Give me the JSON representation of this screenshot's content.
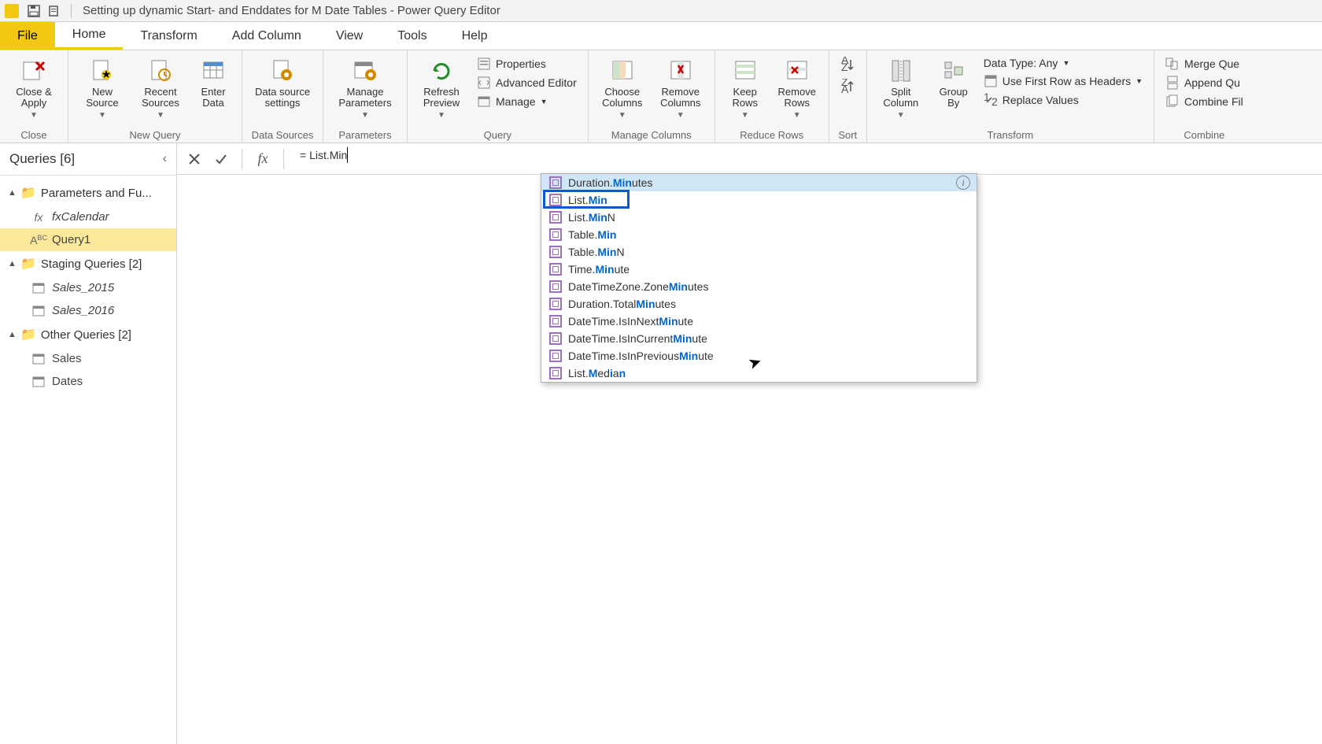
{
  "window": {
    "title": "Setting up dynamic Start- and Enddates for M Date Tables - Power Query Editor"
  },
  "tabs": {
    "file": "File",
    "home": "Home",
    "transform": "Transform",
    "add_column": "Add Column",
    "view": "View",
    "tools": "Tools",
    "help": "Help"
  },
  "ribbon": {
    "close_apply": "Close &\nApply",
    "close_group": "Close",
    "new_source": "New\nSource",
    "recent_sources": "Recent\nSources",
    "enter_data": "Enter\nData",
    "new_query_group": "New Query",
    "data_source_settings": "Data source\nsettings",
    "data_sources_group": "Data Sources",
    "manage_parameters": "Manage\nParameters",
    "parameters_group": "Parameters",
    "refresh_preview": "Refresh\nPreview",
    "properties": "Properties",
    "advanced_editor": "Advanced Editor",
    "manage": "Manage",
    "query_group": "Query",
    "choose_columns": "Choose\nColumns",
    "remove_columns": "Remove\nColumns",
    "manage_columns_group": "Manage Columns",
    "keep_rows": "Keep\nRows",
    "remove_rows": "Remove\nRows",
    "reduce_rows_group": "Reduce Rows",
    "sort_group": "Sort",
    "split_column": "Split\nColumn",
    "group_by": "Group\nBy",
    "data_type": "Data Type: Any",
    "first_row_headers": "Use First Row as Headers",
    "replace_values": "Replace Values",
    "transform_group": "Transform",
    "merge_queries": "Merge Que",
    "append_queries": "Append Qu",
    "combine_files": "Combine Fil",
    "combine_group": "Combine"
  },
  "queries_pane": {
    "title": "Queries [6]",
    "group_params": "Parameters and Fu...",
    "fx_calendar": "fxCalendar",
    "query1": "Query1",
    "group_staging": "Staging Queries [2]",
    "sales_2015": "Sales_2015",
    "sales_2016": "Sales_2016",
    "group_other": "Other Queries [2]",
    "sales": "Sales",
    "dates": "Dates"
  },
  "formula": {
    "prefix": "= ",
    "text": "List.Min"
  },
  "autocomplete": [
    {
      "pre": "Duration.",
      "hl": "Min",
      "post": "utes",
      "info": true
    },
    {
      "pre": "List.",
      "hl": "Min",
      "post": "",
      "focus": true
    },
    {
      "pre": "List.",
      "hl": "Min",
      "post": "N"
    },
    {
      "pre": "Table.",
      "hl": "Min",
      "post": ""
    },
    {
      "pre": "Table.",
      "hl": "Min",
      "post": "N"
    },
    {
      "pre": "Time.",
      "hl": "Min",
      "post": "ute"
    },
    {
      "pre": "DateTimeZone.Zone",
      "hl": "Min",
      "post": "utes"
    },
    {
      "pre": "Duration.Total",
      "hl": "Min",
      "post": "utes"
    },
    {
      "pre": "DateTime.IsInNext",
      "hl": "Min",
      "post": "ute"
    },
    {
      "pre": "DateTime.IsInCurrent",
      "hl": "Min",
      "post": "ute"
    },
    {
      "pre": "DateTime.IsInPrevious",
      "hl": "Min",
      "post": "ute"
    },
    {
      "pre": "List.",
      "hl": "M",
      "post": "ed",
      "hl2": "i",
      "post2": "a",
      "hl3": "n",
      "post3": ""
    }
  ]
}
